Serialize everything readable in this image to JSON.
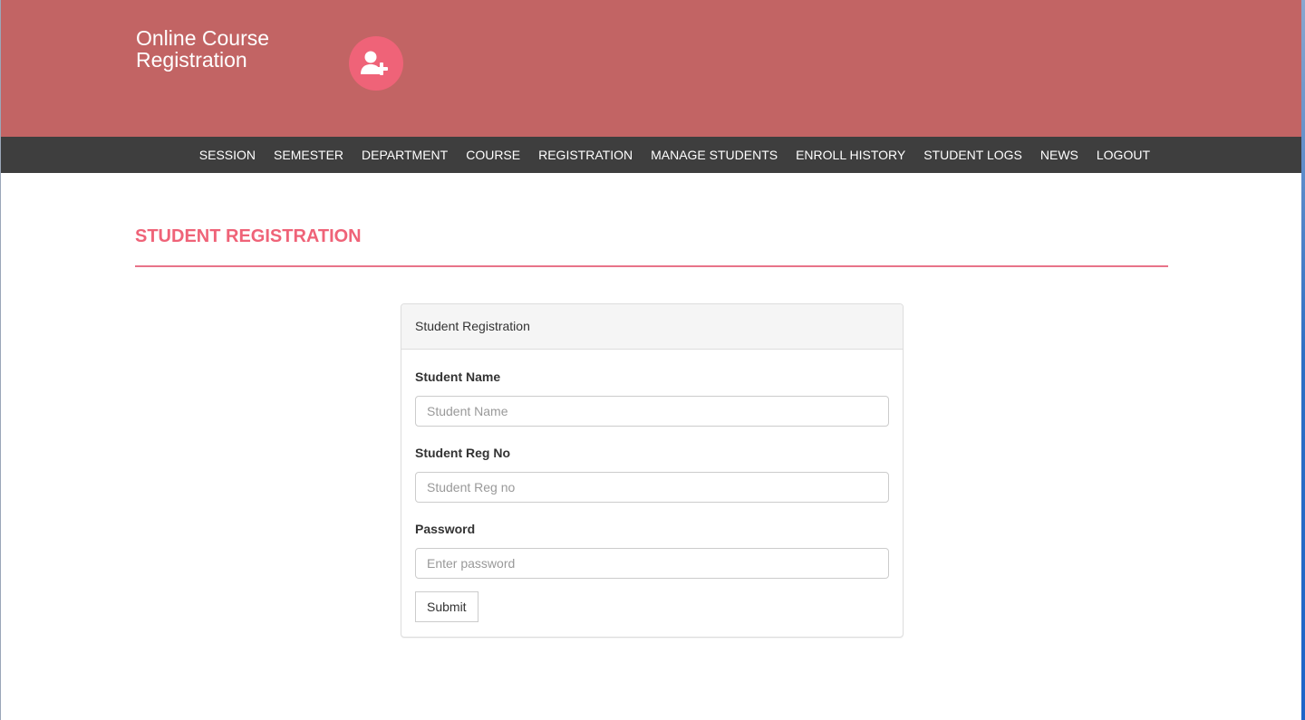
{
  "header": {
    "brand_line1": "Online Course",
    "brand_line2": "Registration",
    "brand_icon": "user-plus-icon",
    "background_color": "#c26464",
    "icon_color": "#ef6378"
  },
  "nav": {
    "items": [
      "SESSION",
      "SEMESTER",
      "DEPARTMENT",
      "COURSE",
      "REGISTRATION",
      "MANAGE STUDENTS",
      "ENROLL HISTORY",
      "STUDENT LOGS",
      "NEWS",
      "LOGOUT"
    ],
    "background_color": "#3e3e3e"
  },
  "main": {
    "page_title": "STUDENT REGISTRATION",
    "accent_color": "#ef6378"
  },
  "form": {
    "panel_title": "Student Registration",
    "fields": [
      {
        "label": "Student Name",
        "placeholder": "Student Name",
        "value": ""
      },
      {
        "label": "Student Reg No",
        "placeholder": "Student Reg no",
        "value": ""
      },
      {
        "label": "Password",
        "placeholder": "Enter password",
        "value": ""
      }
    ],
    "submit_label": "Submit"
  }
}
